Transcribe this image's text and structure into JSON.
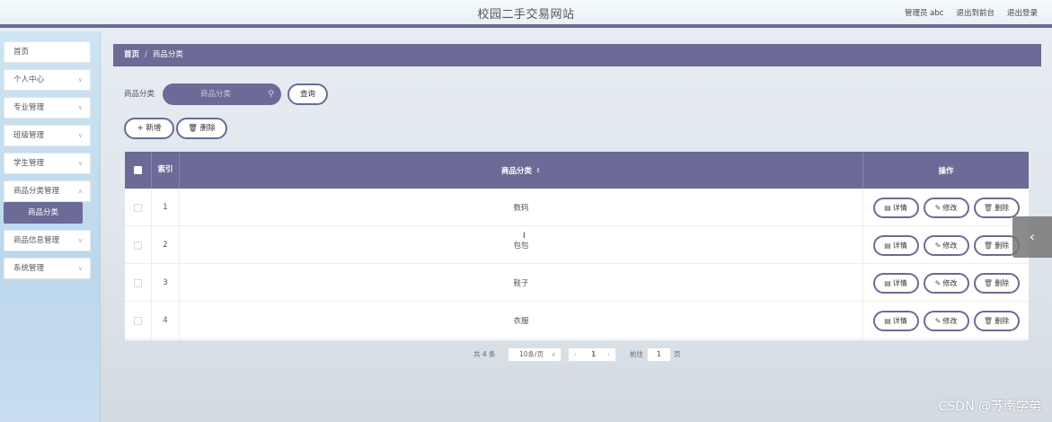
{
  "header": {
    "site_title": "校园二手交易网站",
    "admin_text": "管理员 abc",
    "to_front": "退出到前台",
    "logout": "退出登录"
  },
  "sidebar": {
    "items": [
      {
        "label": "首页"
      },
      {
        "label": "个人中心"
      },
      {
        "label": "专业管理"
      },
      {
        "label": "班级管理"
      },
      {
        "label": "学生管理"
      },
      {
        "label": "商品分类管理"
      },
      {
        "label": "商品信息管理"
      },
      {
        "label": "系统管理"
      }
    ],
    "active_sub": "商品分类"
  },
  "breadcrumb": {
    "home": "首页",
    "separator": "/",
    "current": "商品分类"
  },
  "search": {
    "label": "商品分类",
    "placeholder": "商品分类",
    "query_button": "查询"
  },
  "actions": {
    "add": "新增",
    "delete": "删除"
  },
  "table": {
    "headers": {
      "index": "索引",
      "category": "商品分类",
      "operations": "操作"
    },
    "rows": [
      {
        "index": "1",
        "category": "数码"
      },
      {
        "index": "2",
        "category": "包包"
      },
      {
        "index": "3",
        "category": "鞋子"
      },
      {
        "index": "4",
        "category": "衣服"
      }
    ],
    "row_buttons": {
      "detail": "详情",
      "edit": "修改",
      "delete": "删除"
    }
  },
  "pagination": {
    "total": "共 4 条",
    "page_size": "10条/页",
    "current_page": "1",
    "goto_label": "前往",
    "goto_value": "1",
    "page_unit": "页"
  },
  "watermark": "CSDN @苏南学弟",
  "colors": {
    "accent": "#6c6a96"
  }
}
